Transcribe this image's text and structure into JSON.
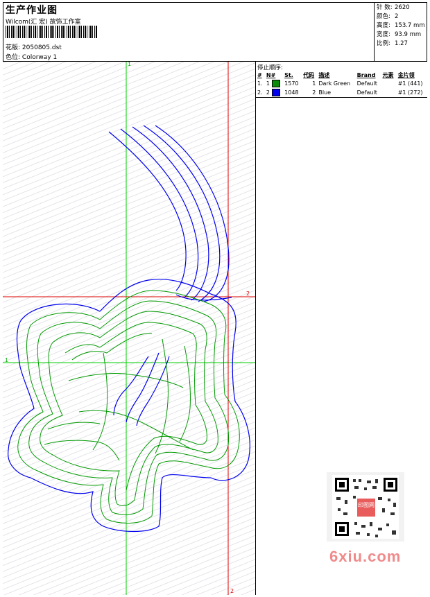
{
  "header": {
    "title": "生产作业图",
    "studio": "Wilcom(汇 宏) 故饰工作室",
    "design_label": "花版:",
    "design_value": "2050805.dst",
    "colorway_label": "色位:",
    "colorway_value": "Colorway 1"
  },
  "stats": [
    {
      "label": "针 数:",
      "value": "2620"
    },
    {
      "label": "颜色:",
      "value": "2"
    },
    {
      "label": "高度:",
      "value": "153.7 mm"
    },
    {
      "label": "宽度:",
      "value": "93.9 mm"
    },
    {
      "label": "比例:",
      "value": "1.27"
    }
  ],
  "stop_sequence": {
    "title": "停止顺序:",
    "columns": [
      "#",
      "N#",
      "St.",
      "代码",
      "描述",
      "Brand",
      "元素",
      "金片领"
    ],
    "rows": [
      {
        "num": "1.",
        "n": "1",
        "color": "#0a8a0a",
        "stitches": "1570",
        "code": "1",
        "desc": "Dark Green",
        "brand": "Default",
        "elements": "",
        "seq": "#1 (441)"
      },
      {
        "num": "2.",
        "n": "2",
        "color": "#0000ee",
        "stitches": "1048",
        "code": "2",
        "desc": "Blue",
        "brand": "Default",
        "elements": "",
        "seq": "#1 (272)"
      }
    ]
  },
  "canvas": {
    "guide_labels": {
      "top_green": "1",
      "left_green": "1",
      "right_red": "2",
      "bottom_red": "2"
    },
    "colors": {
      "green_guide": "#00cc00",
      "red_guide": "#dd0000",
      "stitch_green": "#009900",
      "stitch_blue": "#0000ee"
    }
  },
  "watermark": {
    "text": "6xiu.com",
    "qr_center": "印图网"
  }
}
